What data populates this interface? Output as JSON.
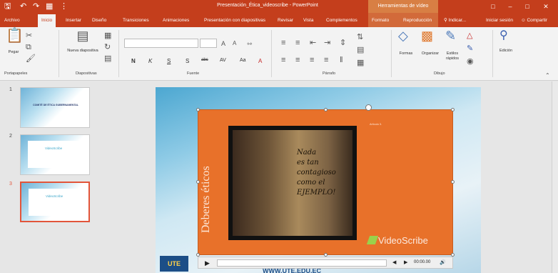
{
  "window": {
    "title": "Presentación_Ética_videoscribe - PowerPoint",
    "context_label": "Herramientas de vídeo"
  },
  "tabs": [
    "Archivo",
    "Inicio",
    "Insertar",
    "Diseño",
    "Transiciones",
    "Animaciones",
    "Presentación con diapositivas",
    "Revisar",
    "Vista",
    "Complementos",
    "Formato",
    "Reproducción"
  ],
  "tell_me": "Indicar...",
  "signin": "Iniciar sesión",
  "share": "Compartir",
  "ribbon": {
    "clipboard": {
      "paste": "Pegar",
      "group": "Portapapeles"
    },
    "slides": {
      "new_slide": "Nueva diapositiva",
      "group": "Diapositivas"
    },
    "font": {
      "group": "Fuente",
      "bold": "N",
      "italic": "K",
      "underline": "S",
      "shadow": "S",
      "strike": "abc"
    },
    "paragraph": {
      "group": "Párrafo"
    },
    "drawing": {
      "shapes": "Formas",
      "arrange": "Organizar",
      "styles": "Estilos rápidos",
      "group": "Dibujo"
    },
    "editing": {
      "edit": "Edición"
    }
  },
  "slides_panel": {
    "numbers": [
      "1",
      "2",
      "3"
    ],
    "thumb1_title": "COMITÉ DE ÉTICA GUBERNAMENTAL",
    "thumb_logo": "VideoScribe"
  },
  "slide": {
    "vertical_title": "Deberes éticos",
    "quote_lines": [
      "Nada",
      "es tan",
      "contagioso",
      "como el",
      "EJEMPLO!"
    ],
    "right_text": "Artículo 3.",
    "watermark": "VideoScribe",
    "url": "WWW.UTE.EDU.EC",
    "logo": "UTE"
  },
  "player": {
    "timecode": "00:00.00"
  }
}
